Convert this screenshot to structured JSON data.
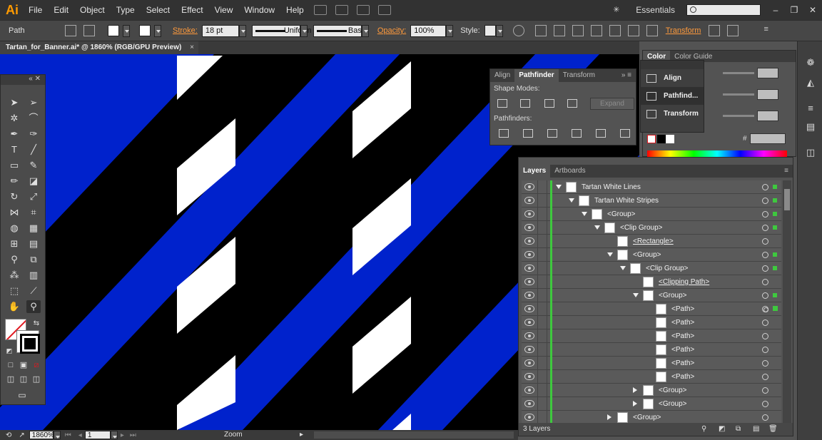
{
  "app": {
    "logo": "Ai",
    "menus": [
      "File",
      "Edit",
      "Object",
      "Type",
      "Select",
      "Effect",
      "View",
      "Window",
      "Help"
    ],
    "workspace": "Essentials",
    "search_placeholder": "",
    "window_controls": [
      "–",
      "❐",
      "✕"
    ]
  },
  "control_bar": {
    "selection_label": "Path",
    "stroke_label": "Stroke:",
    "stroke_weight": "18 pt",
    "profile_label": "Uniform",
    "brush_label": "Basic",
    "opacity_label": "Opacity:",
    "opacity_value": "100%",
    "style_label": "Style:",
    "transform_label": "Transform"
  },
  "document": {
    "tab_title": "Tartan_for_Banner.ai* @ 1860% (RGB/GPU Preview)",
    "tab_close": "×"
  },
  "pathfinder_panel": {
    "tabs": [
      "Align",
      "Pathfinder",
      "Transform"
    ],
    "active_tab": "Pathfinder",
    "shape_modes_label": "Shape Modes:",
    "pathfinders_label": "Pathfinders:",
    "expand_label": "Expand"
  },
  "flyout_menu": {
    "items": [
      "Align",
      "Pathfind...",
      "Transform"
    ],
    "active_item": "Pathfind..."
  },
  "color_panel": {
    "tabs": [
      "Color",
      "Color Guide"
    ],
    "active_tab": "Color",
    "hex_label": "#"
  },
  "layers_panel": {
    "tabs": [
      "Layers",
      "Artboards"
    ],
    "active_tab": "Layers",
    "footer_label": "3 Layers",
    "rows": [
      {
        "name": "Tartan White Lines",
        "depth": 0,
        "expand": "open",
        "underline": false,
        "selected": true
      },
      {
        "name": "Tartan White Stripes",
        "depth": 1,
        "expand": "open",
        "underline": false,
        "selected": true
      },
      {
        "name": "<Group>",
        "depth": 2,
        "expand": "open",
        "underline": false,
        "selected": true
      },
      {
        "name": "<Clip Group>",
        "depth": 3,
        "expand": "open",
        "underline": false,
        "selected": true
      },
      {
        "name": "<Rectangle>",
        "depth": 4,
        "expand": "none",
        "underline": true,
        "selected": false
      },
      {
        "name": "<Group>",
        "depth": 4,
        "expand": "open",
        "underline": false,
        "selected": true
      },
      {
        "name": "<Clip Group>",
        "depth": 5,
        "expand": "open",
        "underline": false,
        "selected": true
      },
      {
        "name": "<Clipping Path>",
        "depth": 6,
        "expand": "none",
        "underline": true,
        "selected": false
      },
      {
        "name": "<Group>",
        "depth": 6,
        "expand": "open",
        "underline": false,
        "selected": true
      },
      {
        "name": "<Path>",
        "depth": 7,
        "expand": "none",
        "underline": false,
        "selected": true,
        "targeted": true
      },
      {
        "name": "<Path>",
        "depth": 7,
        "expand": "none",
        "underline": false,
        "selected": false
      },
      {
        "name": "<Path>",
        "depth": 7,
        "expand": "none",
        "underline": false,
        "selected": false
      },
      {
        "name": "<Path>",
        "depth": 7,
        "expand": "none",
        "underline": false,
        "selected": false
      },
      {
        "name": "<Path>",
        "depth": 7,
        "expand": "none",
        "underline": false,
        "selected": false
      },
      {
        "name": "<Path>",
        "depth": 7,
        "expand": "none",
        "underline": false,
        "selected": false
      },
      {
        "name": "<Group>",
        "depth": 6,
        "expand": "closed",
        "underline": false,
        "selected": false
      },
      {
        "name": "<Group>",
        "depth": 6,
        "expand": "closed",
        "underline": false,
        "selected": false
      },
      {
        "name": "<Group>",
        "depth": 4,
        "expand": "closed",
        "underline": false,
        "selected": false
      }
    ]
  },
  "status_bar": {
    "zoom_value": "1860%",
    "artboard_value": "1",
    "tool_label": "Zoom"
  },
  "colors": {
    "canvas_blue": "#0022cc",
    "stripe_black": "#000000",
    "stripe_white": "#ffffff",
    "accent_orange": "#ff9a00",
    "layer_color_green": "#3ec93e"
  }
}
